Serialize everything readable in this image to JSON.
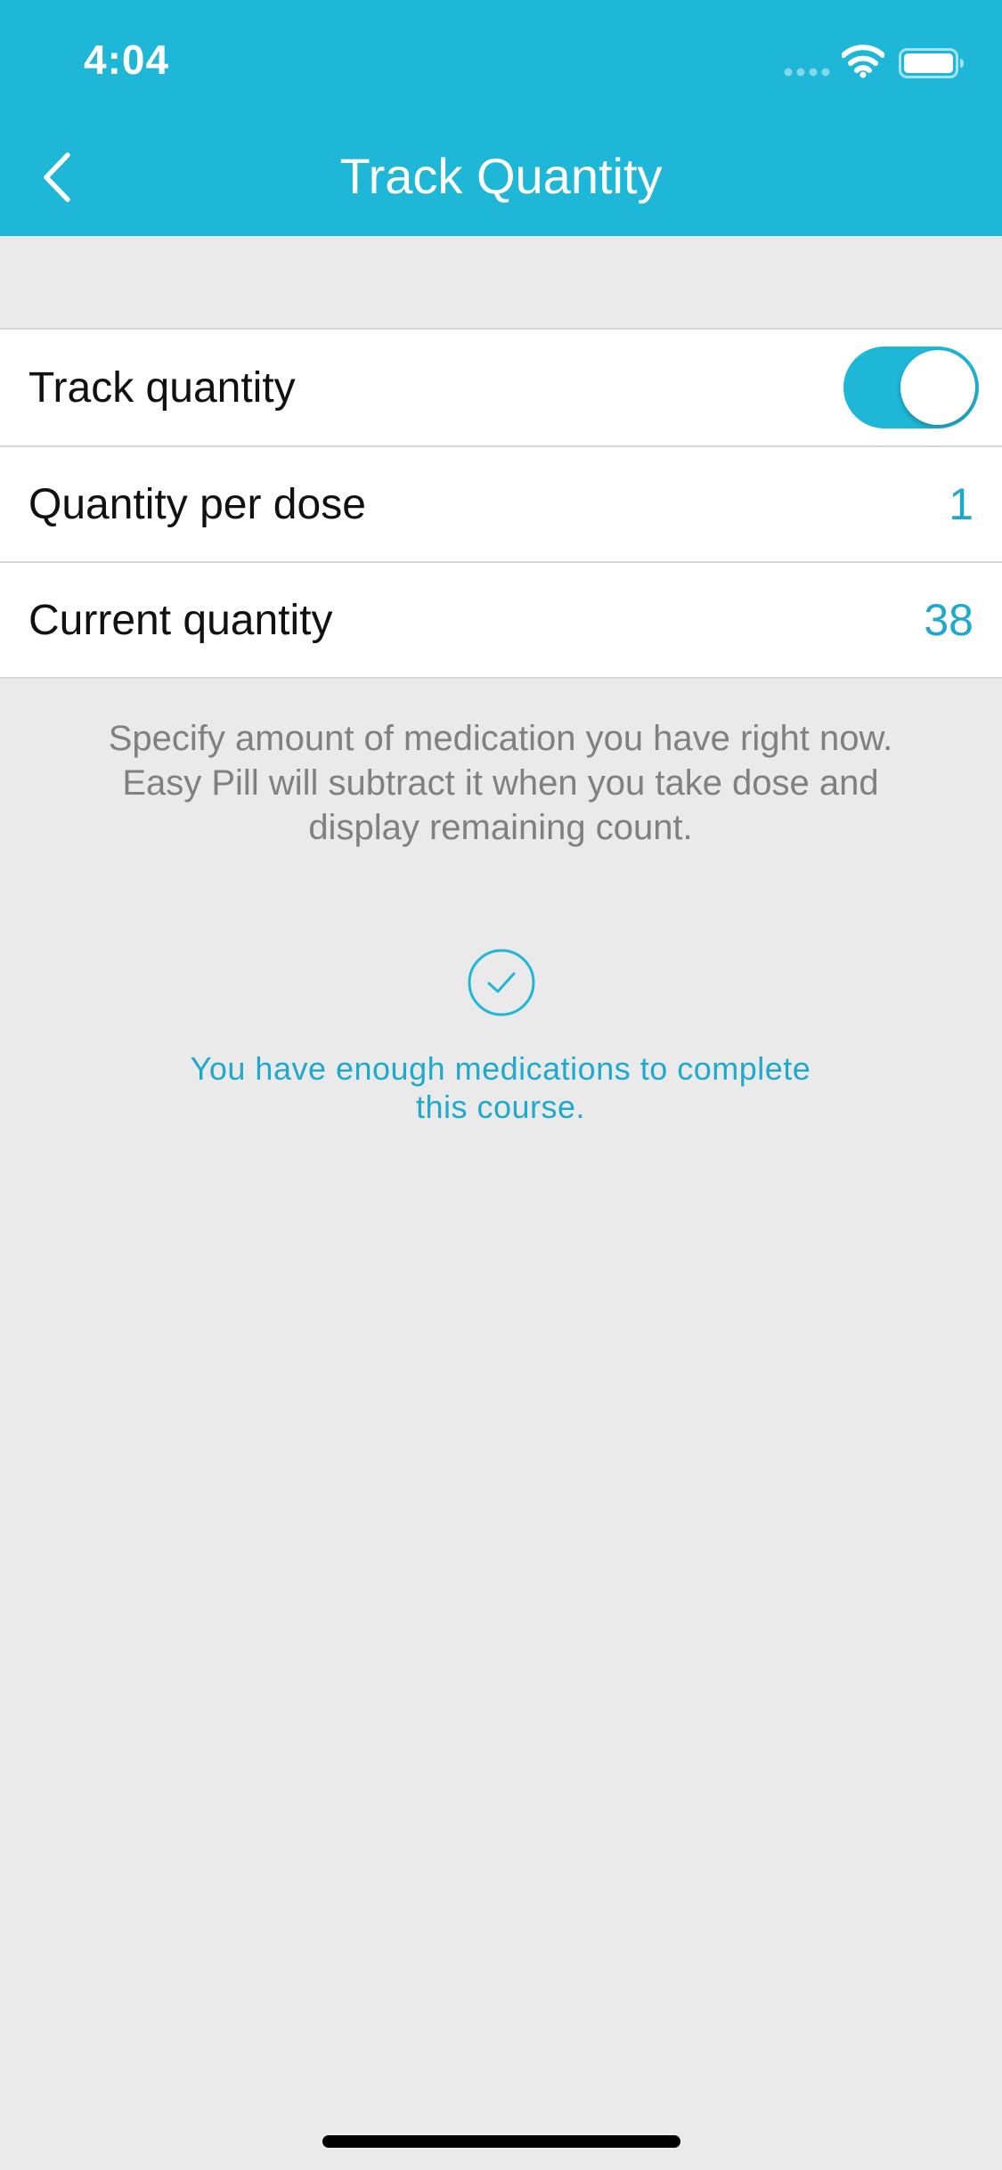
{
  "status_bar": {
    "time": "4:04"
  },
  "nav": {
    "title": "Track Quantity"
  },
  "rows": [
    {
      "label": "Track quantity",
      "toggle_on": true
    },
    {
      "label": "Quantity per dose",
      "value": "1"
    },
    {
      "label": "Current quantity",
      "value": "38"
    }
  ],
  "hint": "Specify amount of medication you have right now. Easy Pill will subtract it when you take dose and display remaining count.",
  "status_message": "You have enough medications to complete this course.",
  "icons": {
    "back": "chevron-left-icon",
    "check": "check-circle-icon",
    "wifi": "wifi-icon",
    "battery": "battery-icon",
    "signal": "signal-icon"
  },
  "colors": {
    "accent": "#1FB7D7",
    "value_text": "#1FA9CC",
    "background": "#EAEAEA"
  }
}
